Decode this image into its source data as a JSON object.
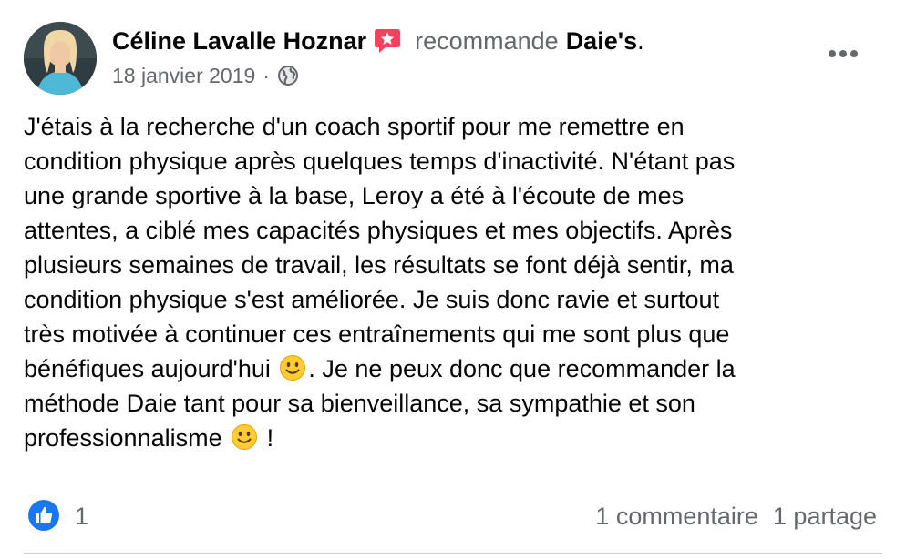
{
  "post": {
    "author": {
      "name": "Céline Lavalle Hoznar",
      "avatar_icon": "profile-photo"
    },
    "recommendation": {
      "icon": "recommendation-star-icon",
      "icon_color": "#f3425f",
      "verb": "recommande",
      "page_name": "Daie's",
      "period": "."
    },
    "date": "18 janvier 2019",
    "separator": "·",
    "privacy_icon": "globe-icon",
    "more_icon": "more-options-icon",
    "body_lines": [
      "J'étais à la recherche d'un coach sportif pour me remettre en",
      "condition physique après quelques temps d'inactivité. N'étant pas",
      "une grande sportive à la base, Leroy a été à l'écoute de mes",
      "attentes, a ciblé mes capacités physiques et mes objectifs. Après",
      "plusieurs semaines de travail, les résultats se font déjà sentir, ma",
      "condition physique s'est améliorée. Je suis donc ravie et surtout",
      "très motivée à continuer ces entraînements qui me sont plus que"
    ],
    "body_line_8_before": "bénéfiques aujourd'hui",
    "body_line_8_after": ". Je ne peux donc que recommander la",
    "body_line_9": "méthode Daie tant pour sa bienveillance, sa sympathie et son",
    "body_line_10_before": "professionnalisme",
    "body_line_10_after": " !",
    "emoji_icon": "smiling-face-emoji"
  },
  "footer": {
    "like_icon": "like-thumb-icon",
    "like_color": "#1877f2",
    "like_count": "1",
    "comments": "1 commentaire",
    "shares": "1 partage"
  }
}
